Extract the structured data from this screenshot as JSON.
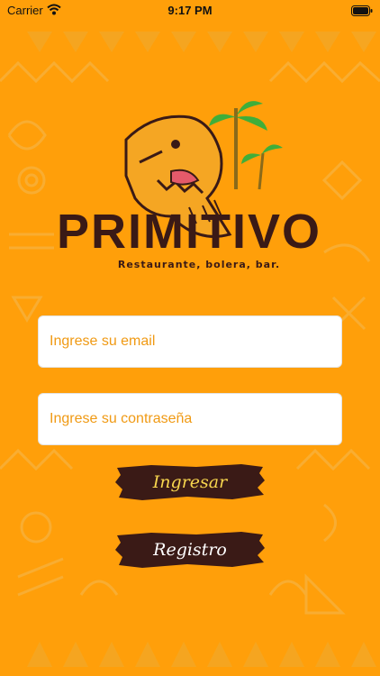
{
  "status_bar": {
    "carrier": "Carrier",
    "time": "9:17 PM"
  },
  "brand": {
    "name": "PRIMITIVO",
    "tagline": "Restaurante, bolera, bar."
  },
  "form": {
    "email_placeholder": "Ingrese su email",
    "password_placeholder": "Ingrese su contraseña",
    "login_label": "Ingresar",
    "register_label": "Registro"
  },
  "colors": {
    "background": "#FF9F0A",
    "brand_text": "#3A1A16",
    "button_bg": "#3A1A16",
    "placeholder": "#F09A14",
    "login_text": "#F8D64E",
    "palm": "#3FAE3A"
  }
}
